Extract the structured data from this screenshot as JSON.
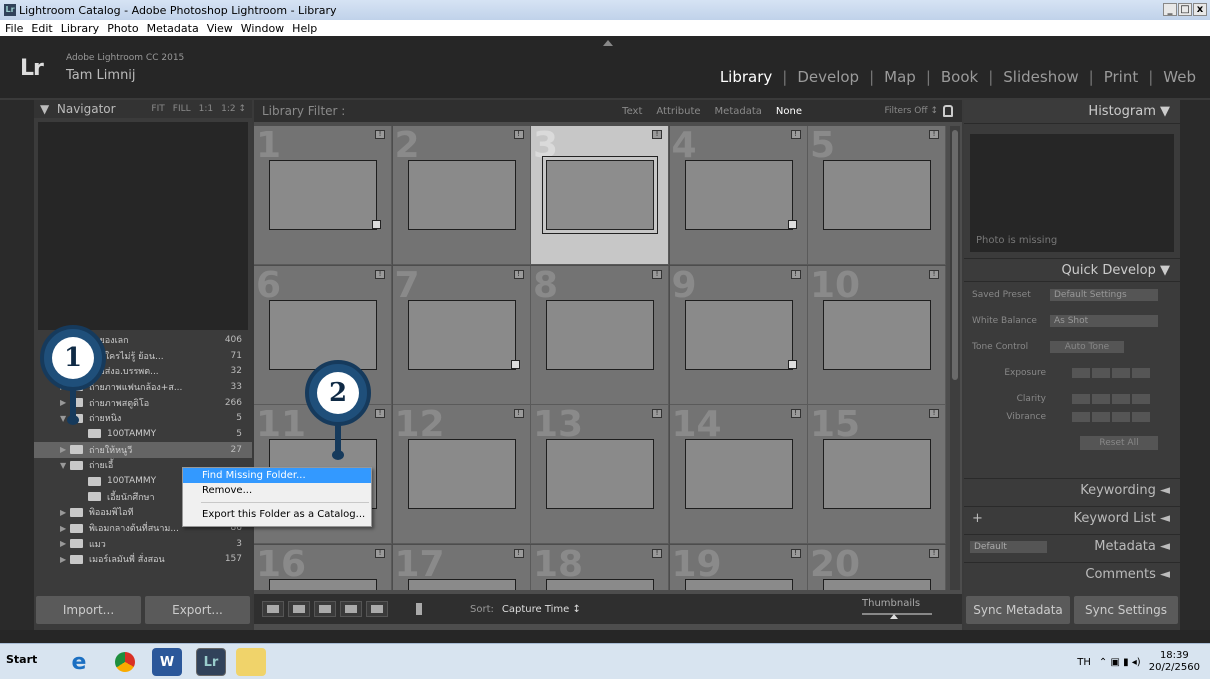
{
  "window": {
    "title": "Lightroom Catalog - Adobe Photoshop Lightroom - Library",
    "app_icon_label": "Lr",
    "controls": [
      "_",
      "□",
      "x"
    ]
  },
  "menu": [
    "File",
    "Edit",
    "Library",
    "Photo",
    "Metadata",
    "View",
    "Window",
    "Help"
  ],
  "identity": {
    "logo": "Lr",
    "product": "Adobe Lightroom CC 2015",
    "user": "Tam Limnij"
  },
  "modules": [
    {
      "label": "Library",
      "active": true
    },
    {
      "label": "Develop"
    },
    {
      "label": "Map"
    },
    {
      "label": "Book"
    },
    {
      "label": "Slideshow"
    },
    {
      "label": "Print"
    },
    {
      "label": "Web"
    }
  ],
  "navigator": {
    "title": "Navigator",
    "options": [
      "FIT",
      "FILL",
      "1:1",
      "1:2 ↕"
    ]
  },
  "folders": [
    {
      "name": "ถ่ายองเลก",
      "count": "406",
      "level": 1
    },
    {
      "name": "ถ่ายใครไม่รู้ ย้อน...",
      "count": "71",
      "level": 1
    },
    {
      "name": "ถ่ายส่งอ.บรรพต...",
      "count": "32",
      "level": 1
    },
    {
      "name": "ถ่ายภาพแฟนกล้อง+ส...",
      "count": "33",
      "level": 1
    },
    {
      "name": "ถ่ายภาพสตูดิโอ",
      "count": "266",
      "level": 1
    },
    {
      "name": "ถ่ายหนิง",
      "count": "5",
      "level": 1,
      "open": true
    },
    {
      "name": "100TAMMY",
      "count": "5",
      "level": 2
    },
    {
      "name": "ถ่ายให้หนูวี",
      "count": "27",
      "level": 1,
      "selected": true,
      "missing": true
    },
    {
      "name": "ถ่ายเอี้",
      "count": "",
      "level": 1,
      "open": true
    },
    {
      "name": "100TAMMY",
      "count": "",
      "level": 2,
      "missing": true
    },
    {
      "name": "เอี้ยนักศึกษา",
      "count": "",
      "level": 2
    },
    {
      "name": "พิออมพิไอที",
      "count": "290",
      "level": 1
    },
    {
      "name": "พิเอมกลางต้นที่สนาม...",
      "count": "86",
      "level": 1
    },
    {
      "name": "แมว",
      "count": "3",
      "level": 1
    },
    {
      "name": "เมอร์เลมันพี่ สั่งสอน",
      "count": "157",
      "level": 1
    }
  ],
  "left_buttons": {
    "import": "Import...",
    "export": "Export..."
  },
  "filter": {
    "label": "Library Filter :",
    "tabs": [
      "Text",
      "Attribute",
      "Metadata",
      "None"
    ],
    "active_tab": "None",
    "status": "Filters Off ↕"
  },
  "grid_numbers": [
    "1",
    "2",
    "3",
    "4",
    "5",
    "6",
    "7",
    "8",
    "9",
    "10",
    "11",
    "12",
    "13",
    "14",
    "15",
    "16",
    "17",
    "18",
    "19",
    "20"
  ],
  "selected_cell": "3",
  "toolbar": {
    "sort_label": "Sort:",
    "sort_value": "Capture Time ↕",
    "thumbnails_label": "Thumbnails"
  },
  "right": {
    "histogram": "Histogram ▼",
    "photo_missing": "Photo is missing",
    "quick_develop": "Quick Develop ▼",
    "saved_preset": "Saved Preset",
    "saved_preset_value": "Default Settings",
    "white_balance": "White Balance",
    "white_balance_value": "As Shot",
    "tone_control": "Tone Control",
    "auto_tone": "Auto Tone",
    "exposure": "Exposure",
    "clarity": "Clarity",
    "vibrance": "Vibrance",
    "reset_all": "Reset All",
    "keywording": "Keywording ◄",
    "keyword_list": "Keyword List ◄",
    "metadata": "Metadata ◄",
    "metadata_preset": "Default",
    "comments": "Comments ◄",
    "sync_metadata": "Sync Metadata",
    "sync_settings": "Sync Settings",
    "plus": "+"
  },
  "context_menu": {
    "items": [
      "Find Missing Folder...",
      "Remove...",
      "Export this Folder as a Catalog..."
    ]
  },
  "callouts": {
    "one": "1",
    "two": "2"
  },
  "taskbar": {
    "start": "Start",
    "lang": "TH",
    "time": "18:39",
    "date": "20/2/2560"
  }
}
